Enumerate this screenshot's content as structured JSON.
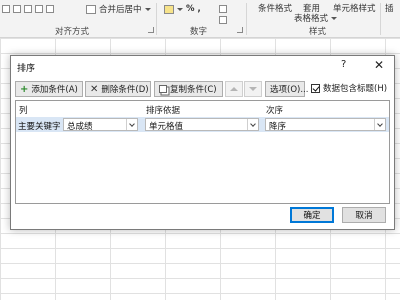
{
  "ribbon": {
    "merge_center_label": "合并后居中",
    "number_format_symbol": "%",
    "thousands_symbol": ",",
    "conditional_format_label": "条件格式",
    "apply_label": "套用",
    "table_format_label": "表格格式",
    "cell_style_label": "单元格样式",
    "insert_label": "插",
    "groups": {
      "alignment": "对齐方式",
      "number": "数字",
      "style": "样式"
    }
  },
  "dialog": {
    "title": "排序",
    "help": "?",
    "close": "✕",
    "toolbar": {
      "add": "添加条件(A)",
      "delete": "删除条件(D)",
      "copy": "复制条件(C)",
      "options": "选项(O)...",
      "has_headers": "数据包含标题(H)",
      "has_headers_checked": true
    },
    "columns": {
      "column": "列",
      "sort_on": "排序依据",
      "order": "次序"
    },
    "row": {
      "label": "主要关键字",
      "column": "总成绩",
      "sort_on": "单元格值",
      "order": "降序"
    },
    "ok": "确定",
    "cancel": "取消"
  }
}
